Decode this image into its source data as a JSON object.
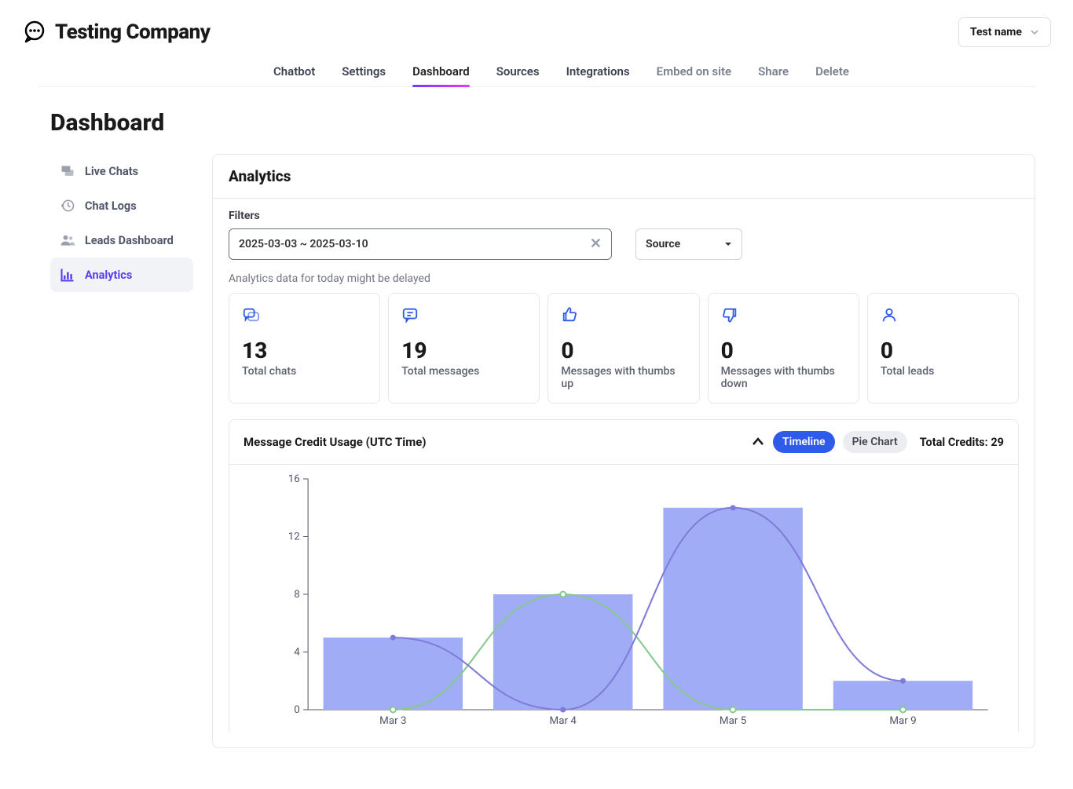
{
  "brand": {
    "name": "Testing Company"
  },
  "user_select": {
    "label": "Test name"
  },
  "tabs": {
    "chatbot": "Chatbot",
    "settings": "Settings",
    "dashboard": "Dashboard",
    "sources": "Sources",
    "integrations": "Integrations",
    "embed": "Embed on site",
    "share": "Share",
    "delete": "Delete"
  },
  "page_title": "Dashboard",
  "sidebar": {
    "live_chats": "Live Chats",
    "chat_logs": "Chat Logs",
    "leads": "Leads Dashboard",
    "analytics": "Analytics"
  },
  "panel": {
    "title": "Analytics"
  },
  "filters": {
    "label": "Filters",
    "date_range": "2025-03-03 ~ 2025-03-10",
    "source_label": "Source"
  },
  "note": "Analytics data for today might be delayed",
  "stats": {
    "total_chats": {
      "value": "13",
      "label": "Total chats"
    },
    "total_messages": {
      "value": "19",
      "label": "Total messages"
    },
    "thumbs_up": {
      "value": "0",
      "label": "Messages with thumbs up"
    },
    "thumbs_down": {
      "value": "0",
      "label": "Messages with thumbs down"
    },
    "total_leads": {
      "value": "0",
      "label": "Total leads"
    }
  },
  "chart": {
    "title": "Message Credit Usage (UTC Time)",
    "timeline_btn": "Timeline",
    "pie_btn": "Pie Chart",
    "credits_label": "Total Credits: 29"
  },
  "chart_data": {
    "type": "bar",
    "categories": [
      "Mar 3",
      "Mar 4",
      "Mar 5",
      "Mar 9"
    ],
    "values": [
      5,
      8,
      14,
      2
    ],
    "series_lines": {
      "purple": [
        5,
        0,
        14,
        2
      ],
      "green": [
        0,
        8,
        0,
        0
      ]
    },
    "y_ticks": [
      0,
      4,
      8,
      12,
      16
    ],
    "ylim": [
      0,
      16
    ],
    "title": "Message Credit Usage (UTC Time)",
    "xlabel": "",
    "ylabel": ""
  }
}
